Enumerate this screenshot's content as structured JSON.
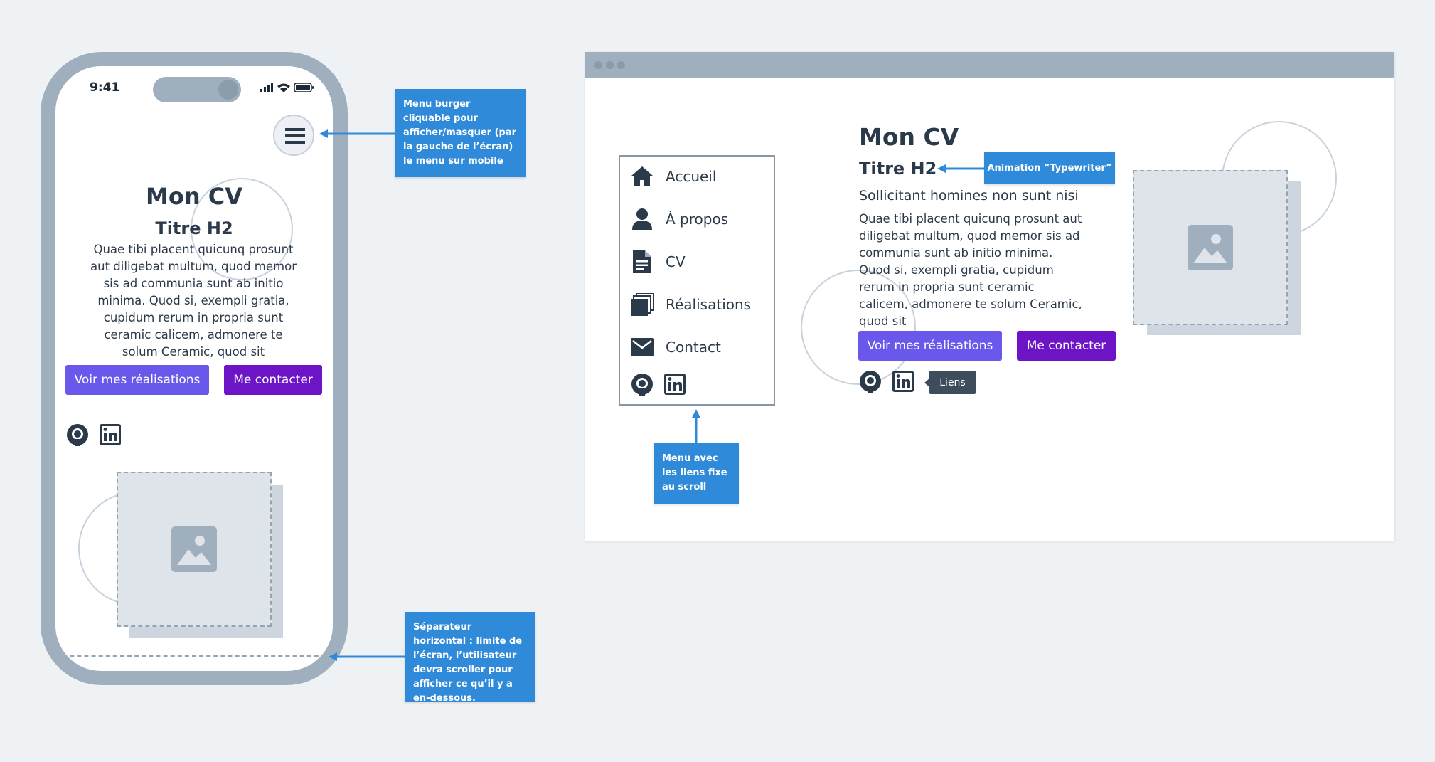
{
  "mobile": {
    "time": "9:41",
    "title": "Mon CV",
    "subtitle": "Titre H2",
    "text": "Quae tibi placent quicunq prosunt aut diligebat multum, quod memor sis ad communia sunt ab initio minima. Quod si, exempli gratia, cupidum rerum in propria sunt ceramic calicem, admonere te solum Ceramic, quod sit",
    "buttons": {
      "primary": "Voir mes réalisations",
      "secondary": "Me contacter"
    },
    "social": [
      "github",
      "linkedin"
    ]
  },
  "desktop": {
    "menu": [
      {
        "label": "Accueil",
        "icon": "home-icon"
      },
      {
        "label": "À propos",
        "icon": "user-icon"
      },
      {
        "label": "CV",
        "icon": "document-icon"
      },
      {
        "label": "Réalisations",
        "icon": "stack-icon"
      },
      {
        "label": "Contact",
        "icon": "envelope-icon"
      }
    ],
    "title": "Mon CV",
    "subtitle": "Titre H2",
    "tagline": "Sollicitant homines non sunt nisi",
    "text": "Quae tibi placent quicunq prosunt aut diligebat multum, quod memor sis ad communia sunt ab initio minima. Quod si, exempli gratia, cupidum rerum in propria sunt ceramic calicem, admonere te solum Ceramic, quod sit",
    "buttons": {
      "primary": "Voir mes réalisations",
      "secondary": "Me contacter"
    },
    "tooltip": "Liens"
  },
  "annotations": {
    "burger": "Menu burger cliquable pour afficher/masquer (par la gauche de l’écran)  le menu sur mobile",
    "menu": "Menu avec les liens fixe au scroll",
    "typewriter": "Animation “Typewriter”",
    "separator": "Séparateur horizontal : limite de l’écran, l’utilisateur devra scroller pour afficher ce qu’il y a en-dessous."
  },
  "colors": {
    "background": "#eff2f5",
    "frame": "#9fafbd",
    "callout": "#2f8bd9",
    "button_primary": "#6a57ec",
    "button_secondary": "#6d14c6",
    "text": "#2b3a4a"
  }
}
